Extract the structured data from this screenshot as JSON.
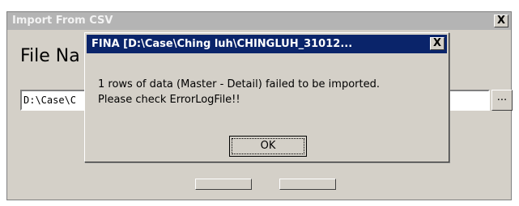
{
  "parent_window": {
    "title": "Import From CSV",
    "close_glyph": "X",
    "heading": "File Na",
    "path_value": "D:\\Case\\C",
    "browse_label": "..."
  },
  "message_box": {
    "title": "FINA  [D:\\Case\\Ching luh\\CHINGLUH_31012...",
    "close_glyph": "X",
    "line1": "1 rows of data (Master - Detail) failed to be imported.",
    "line2": "Please check ErrorLogFile!!",
    "ok_label": "OK"
  }
}
